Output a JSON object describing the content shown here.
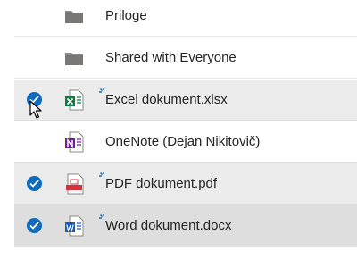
{
  "files": [
    {
      "name": "Priloge",
      "type": "folder",
      "selected": false,
      "is_new": false
    },
    {
      "name": "Shared with Everyone",
      "type": "folder",
      "selected": false,
      "is_new": false
    },
    {
      "name": "Excel dokument.xlsx",
      "type": "excel",
      "selected": true,
      "is_new": true
    },
    {
      "name": "OneNote (Dejan Nikitovič)",
      "type": "onenote",
      "selected": false,
      "is_new": false
    },
    {
      "name": "PDF dokument.pdf",
      "type": "pdf",
      "selected": true,
      "is_new": true
    },
    {
      "name": "Word dokument.docx",
      "type": "word",
      "selected": true,
      "is_new": true
    }
  ],
  "colors": {
    "accent": "#0f6cbd",
    "folder": "#8a8886",
    "excel": "#107c41",
    "onenote": "#7719aa",
    "pdf": "#d13438",
    "word": "#185abd"
  }
}
